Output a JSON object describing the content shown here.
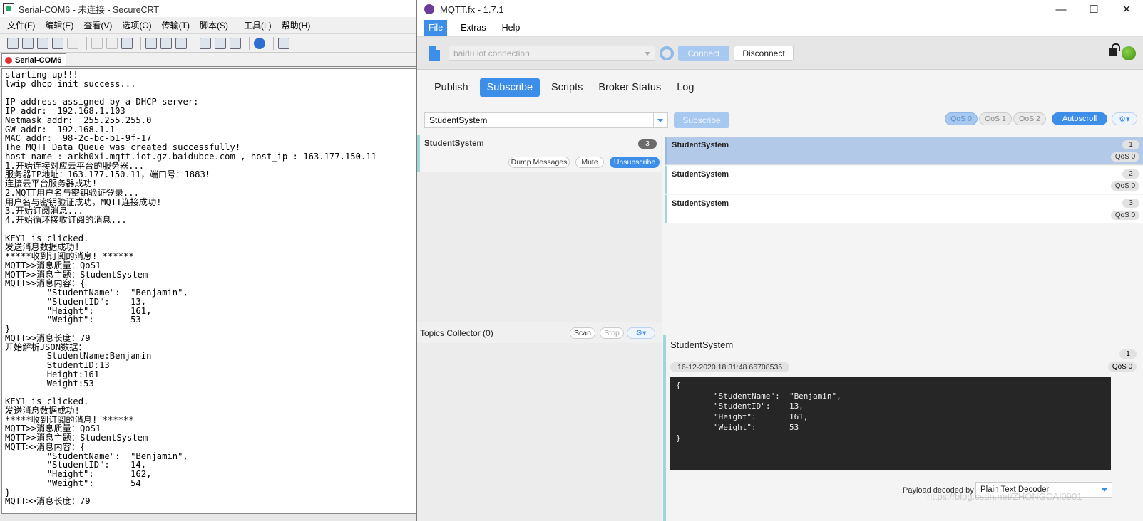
{
  "crt": {
    "title": "Serial-COM6 - 未连接 - SecureCRT",
    "menu": [
      "文件(F)",
      "编辑(E)",
      "查看(V)",
      "选项(O)",
      "传输(T)",
      "脚本(S)",
      "工具(L)",
      "帮助(H)"
    ],
    "tab": "Serial-COM6",
    "terminal": "starting up!!!\nlwip dhcp init success...\n\nIP address assigned by a DHCP server:\nIP addr:  192.168.1.103\nNetmask addr:  255.255.255.0\nGW addr:  192.168.1.1\nMAC addr:  98-2c-bc-b1-9f-17\nThe MQTT_Data_Queue was created successfully!\nhost name : arkh0xi.mqtt.iot.gz.baidubce.com , host_ip : 163.177.150.11\n1.开始连接对应云平台的服务器...\n服务器IP地址：163.177.150.11，端口号：1883!\n连接云平台服务器成功!\n2.MQTT用户名与密钥验证登录...\n用户名与密钥验证成功，MQTT连接成功!\n3.开始订阅消息...\n4.开始循环接收订阅的消息...\n\nKEY1 is clicked.\n发送消息数据成功!\n*****收到订阅的消息! ******\nMQTT>>消息质量：QoS1\nMQTT>>消息主题：StudentSystem\nMQTT>>消息内容：{\n        \"StudentName\":  \"Benjamin\",\n        \"StudentID\":    13,\n        \"Height\":       161,\n        \"Weight\":       53\n}\nMQTT>>消息长度：79\n开始解析JSON数据：\n        StudentName:Benjamin\n        StudentID:13\n        Height:161\n        Weight:53\n\nKEY1 is clicked.\n发送消息数据成功!\n*****收到订阅的消息! ******\nMQTT>>消息质量：QoS1\nMQTT>>消息主题：StudentSystem\nMQTT>>消息内容：{\n        \"StudentName\":  \"Benjamin\",\n        \"StudentID\":    14,\n        \"Height\":       162,\n        \"Weight\":       54\n}\nMQTT>>消息长度：79"
  },
  "mqtt": {
    "title": "MQTT.fx - 1.7.1",
    "window_buttons": [
      "—",
      "☐",
      "✕"
    ],
    "menu": [
      "File",
      "Extras",
      "Help"
    ],
    "connection_profile": "baidu iot connection",
    "connect_label": "Connect",
    "disconnect_label": "Disconnect",
    "tabs": [
      "Publish",
      "Subscribe",
      "Scripts",
      "Broker Status",
      "Log"
    ],
    "topic_input": "StudentSystem",
    "subscribe_label": "Subscribe",
    "qos_options": [
      "QoS 0",
      "QoS 1",
      "QoS 2"
    ],
    "autoscroll_label": "Autoscroll",
    "settings_glyph": "⚙▾",
    "subscription": {
      "topic": "StudentSystem",
      "count": "3",
      "dump_label": "Dump Messages",
      "mute_label": "Mute",
      "unsubscribe_label": "Unsubscribe"
    },
    "collector": {
      "title": "Topics Collector (0)",
      "scan_label": "Scan",
      "stop_label": "Stop"
    },
    "messages": [
      {
        "topic": "StudentSystem",
        "num": "1",
        "qos": "QoS 0"
      },
      {
        "topic": "StudentSystem",
        "num": "2",
        "qos": "QoS 0"
      },
      {
        "topic": "StudentSystem",
        "num": "3",
        "qos": "QoS 0"
      }
    ],
    "detail": {
      "topic": "StudentSystem",
      "num": "1",
      "timestamp": "16-12-2020  18:31:48.66708535",
      "qos": "QoS 0",
      "payload": "{\n        \"StudentName\":  \"Benjamin\",\n        \"StudentID\":    13,\n        \"Height\":       161,\n        \"Weight\":       53\n}",
      "decoder_label": "Payload decoded by",
      "decoder_value": "Plain Text Decoder"
    },
    "colors": {
      "accent": "#3d8ee8",
      "led": "#5aa82a",
      "payload_bg": "#262626"
    }
  },
  "watermark": "https://blog.csdn.net/ZHONGCAI0901"
}
